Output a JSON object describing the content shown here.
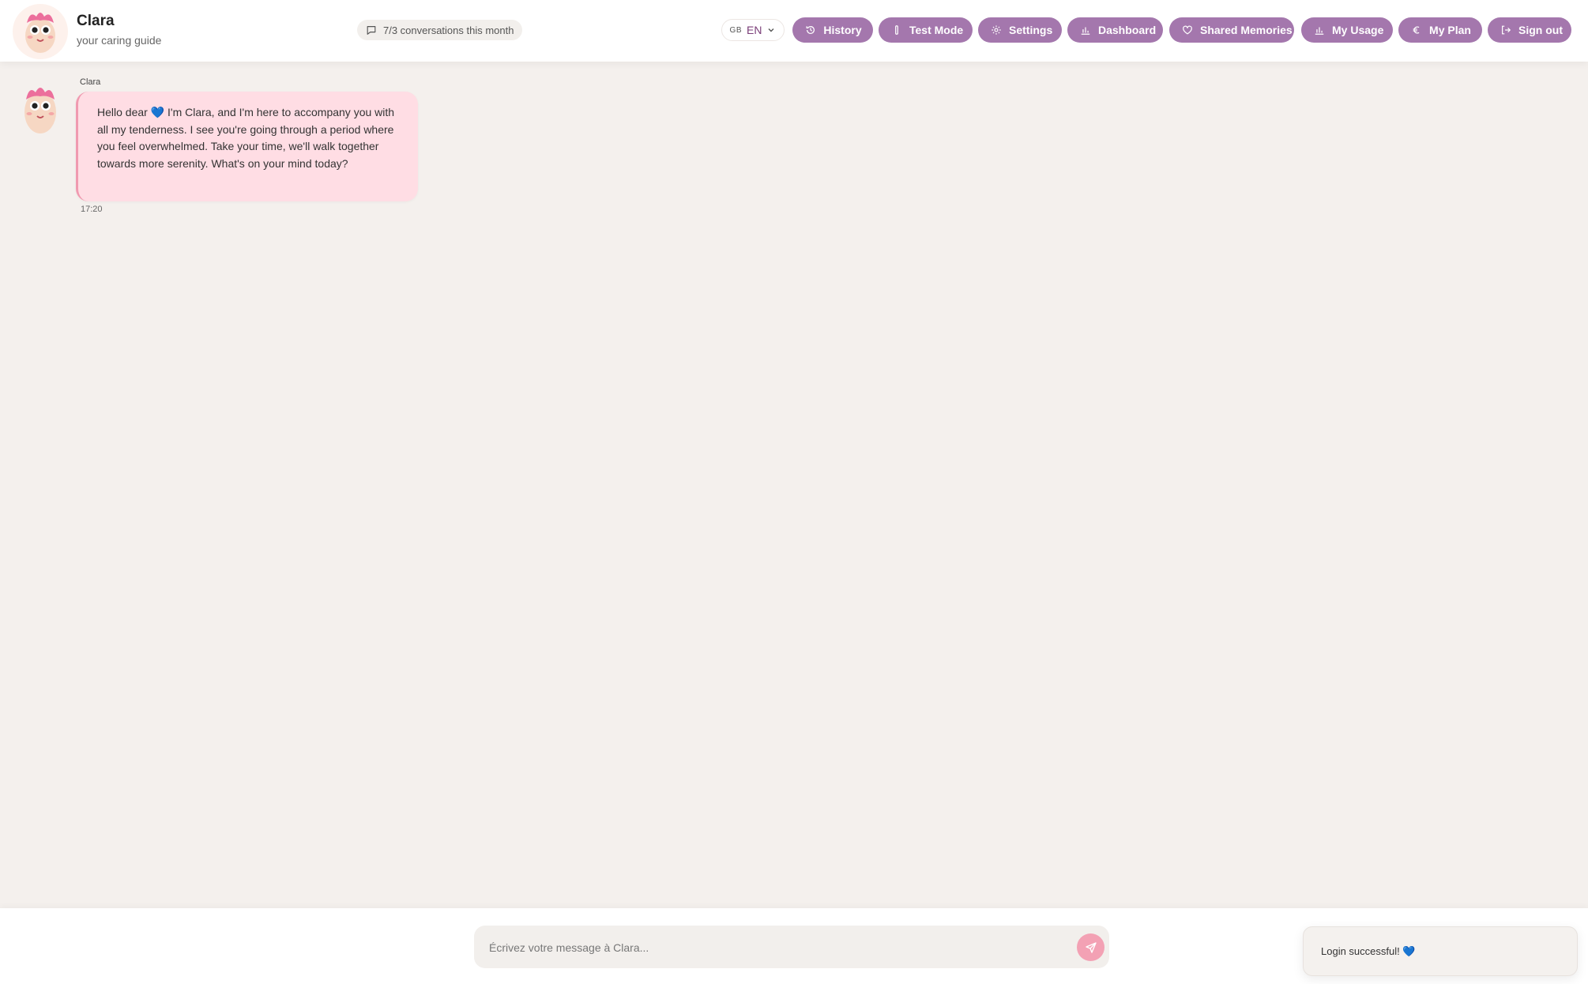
{
  "header": {
    "name": "Clara",
    "subtitle": "your caring guide",
    "usage": "7/3 conversations this month",
    "language": {
      "flag": "GB",
      "code": "EN"
    },
    "nav": [
      {
        "label": "History",
        "icon": "history-icon"
      },
      {
        "label": "Test Mode",
        "icon": "flask-icon"
      },
      {
        "label": "Settings",
        "icon": "gear-icon"
      },
      {
        "label": "Dashboard",
        "icon": "bar-chart-icon"
      },
      {
        "label": "Shared Memories",
        "icon": "heart-icon"
      },
      {
        "label": "My Usage",
        "icon": "bar-chart-icon"
      },
      {
        "label": "My Plan",
        "icon": "euro-icon"
      },
      {
        "label": "Sign out",
        "icon": "sign-out-icon"
      }
    ]
  },
  "messages": [
    {
      "sender": "Clara",
      "text_before": "Hello dear ",
      "emoji": "💙",
      "text_after": " I'm Clara, and I'm here to accompany you with all my tenderness. I see you're going through a period where you feel overwhelmed. Take your time, we'll walk together towards more serenity. What's on your mind today?",
      "time": "17:20"
    }
  ],
  "composer": {
    "placeholder": "Écrivez votre message à Clara..."
  },
  "toast": {
    "text": "Login successful!",
    "emoji": "💙"
  },
  "colors": {
    "nav_button": "#a477ad",
    "bubble": "#ffdde4",
    "bubble_border": "#f09ab0",
    "send_button": "#f3a1b4",
    "background": "#f4f0ed"
  }
}
